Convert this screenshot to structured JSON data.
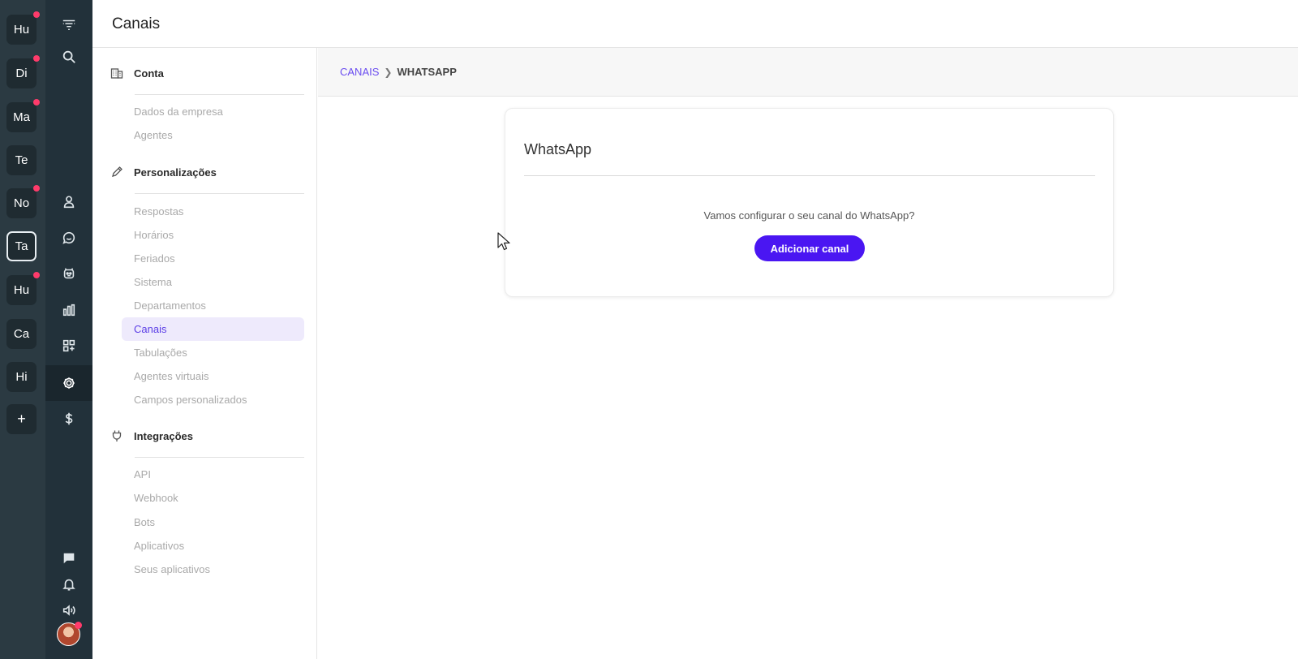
{
  "workspaces": [
    {
      "label": "Hu",
      "dot": true
    },
    {
      "label": "Di",
      "dot": true
    },
    {
      "label": "Ma",
      "dot": true
    },
    {
      "label": "Te",
      "dot": false
    },
    {
      "label": "No",
      "dot": true
    },
    {
      "label": "Ta",
      "dot": false,
      "active": true
    },
    {
      "label": "Hu",
      "dot": true
    },
    {
      "label": "Ca",
      "dot": false
    },
    {
      "label": "Hi",
      "dot": false
    },
    {
      "label": "+",
      "dot": false
    }
  ],
  "icons": {
    "nav": [
      "logo-icon",
      "search-icon",
      "contacts-icon",
      "chat-support-icon",
      "bot-icon",
      "reports-icon",
      "apps-icon",
      "settings-icon",
      "billing-icon"
    ],
    "bottom": [
      "messages-icon",
      "bell-icon",
      "sound-icon"
    ]
  },
  "header": {
    "title": "Canais"
  },
  "sidebar": {
    "sections": [
      {
        "title": "Conta",
        "icon": "building-icon",
        "items": [
          "Dados da empresa",
          "Agentes"
        ]
      },
      {
        "title": "Personalizações",
        "icon": "pencil-icon",
        "items": [
          "Respostas",
          "Horários",
          "Feriados",
          "Sistema",
          "Departamentos",
          "Canais",
          "Tabulações",
          "Agentes virtuais",
          "Campos personalizados"
        ]
      },
      {
        "title": "Integrações",
        "icon": "plug-icon",
        "items": [
          "API",
          "Webhook",
          "Bots",
          "Aplicativos",
          "Seus aplicativos"
        ]
      }
    ],
    "active_item": "Canais"
  },
  "breadcrumb": {
    "parent": "CANAIS",
    "current": "WHATSAPP"
  },
  "card": {
    "title": "WhatsApp",
    "message": "Vamos configurar o seu canal do WhatsApp?",
    "button_label": "Adicionar canal"
  },
  "colors": {
    "rail": "#2b3a42",
    "nav": "#22313a",
    "accent": "#4a16f2",
    "link": "#6a4df0",
    "active_bg": "#eeeafc",
    "notification": "#ff3b6b"
  }
}
